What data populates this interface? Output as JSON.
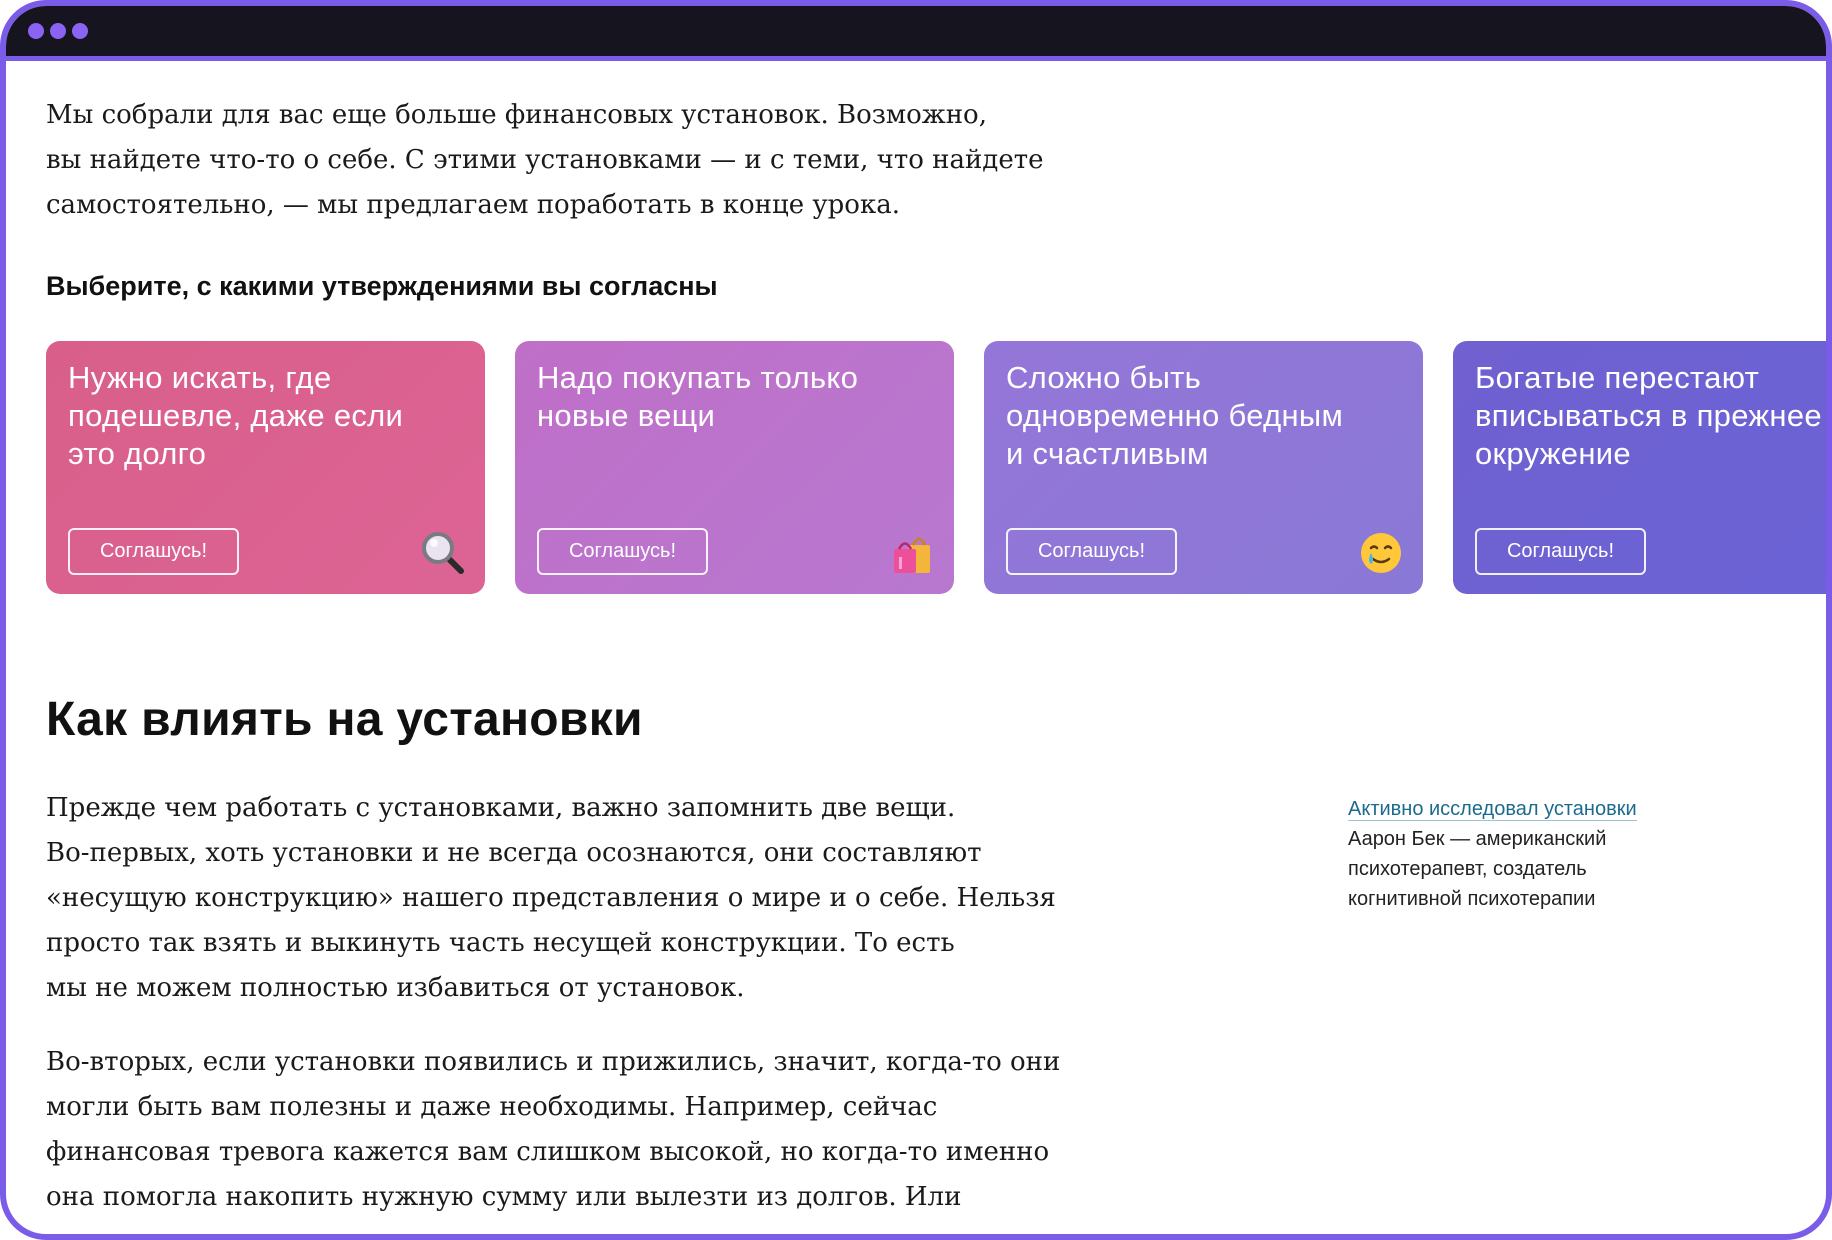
{
  "intro": [
    "Мы собрали для вас еще больше финансовых установок. Возможно,",
    "вы найдете что-то о себе. С этими установками — и с теми, что найдете",
    "самостоятельно, — мы предлагаем поработать в конце урока."
  ],
  "subheading": "Выберите, с какими утверждениями вы согласны",
  "cards": [
    {
      "text": "Нужно искать, где\nподешевле, даже если\nэто долго",
      "button": "Соглашусь!",
      "icon": "magnifying-glass-icon",
      "color": "#d95f8a"
    },
    {
      "text": "Надо покупать только\nновые вещи",
      "button": "Соглашусь!",
      "icon": "shopping-bags-icon",
      "color": "#bb74cc"
    },
    {
      "text": "Сложно быть\nодновременно бедным\nи счастливым",
      "button": "Соглашусь!",
      "icon": "smiling-face-with-tear-icon",
      "color": "#8f78d8"
    },
    {
      "text": "Богатые перестают\nвписываться в прежнее\nокружение",
      "button": "Соглашусь!",
      "icon": "",
      "color": "#6e62d2"
    }
  ],
  "section_title": "Как влиять на установки",
  "paragraph1": [
    "Прежде чем работать с установками, важно запомнить две вещи.",
    "Во-первых, хоть установки и не всегда осознаются, они составляют",
    "«несущую конструкцию» нашего представления о мире и о себе. Нельзя",
    "просто так взять и выкинуть часть несущей конструкции. То есть",
    "мы не можем полностью избавиться от установок."
  ],
  "paragraph2": [
    "Во-вторых, если установки появились и прижились, значит, когда-то они",
    "могли быть вам полезны и даже необходимы. Например, сейчас",
    "финансовая тревога кажется вам слишком высокой, но когда-то именно",
    "она помогла накопить нужную сумму или вылезти из долгов. Или"
  ],
  "sidenote": {
    "link": "Активно исследовал установки",
    "lines": [
      "Аарон Бек — американский",
      "психотерапевт, создатель",
      "когнитивной психотерапии"
    ]
  },
  "colors": {
    "frame": "#7b5ce8",
    "titlebar": "#16141e",
    "dots": "#8b63f2",
    "link": "#1b6b8f"
  }
}
